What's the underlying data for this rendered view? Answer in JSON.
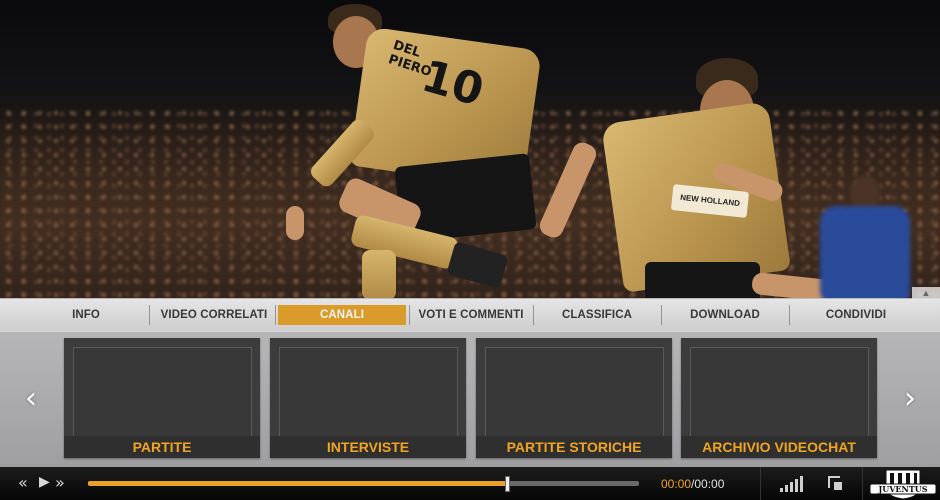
{
  "nav": {
    "tabs": [
      {
        "label": "INFO",
        "active": false
      },
      {
        "label": "VIDEO CORRELATI",
        "active": false
      },
      {
        "label": "CANALI",
        "active": true
      },
      {
        "label": "VOTI E COMMENTI",
        "active": false
      },
      {
        "label": "CLASSIFICA",
        "active": false
      },
      {
        "label": "DOWNLOAD",
        "active": false
      },
      {
        "label": "CONDIVIDI",
        "active": false
      }
    ]
  },
  "channels": {
    "prev_icon": "chevron-left-icon",
    "next_icon": "chevron-right-icon",
    "cards": [
      {
        "title": "PARTITE"
      },
      {
        "title": "INTERVISTE"
      },
      {
        "title": "PARTITE STORICHE"
      },
      {
        "title": "ARCHIVIO VIDEOCHAT"
      }
    ]
  },
  "hero": {
    "jersey_name": "DEL PIERO",
    "jersey_number": "10",
    "sponsor": "NEW HOLLAND"
  },
  "player": {
    "progress": 0.76,
    "current_time": "00:00",
    "separator": "/",
    "total_time": "00:00",
    "icons": [
      "rewind-icon",
      "play-icon",
      "fast-forward-icon",
      "volume-icon",
      "fullscreen-icon"
    ]
  },
  "brand": {
    "logo_text": "JUVENTUS",
    "accent": "#e3a12c"
  }
}
